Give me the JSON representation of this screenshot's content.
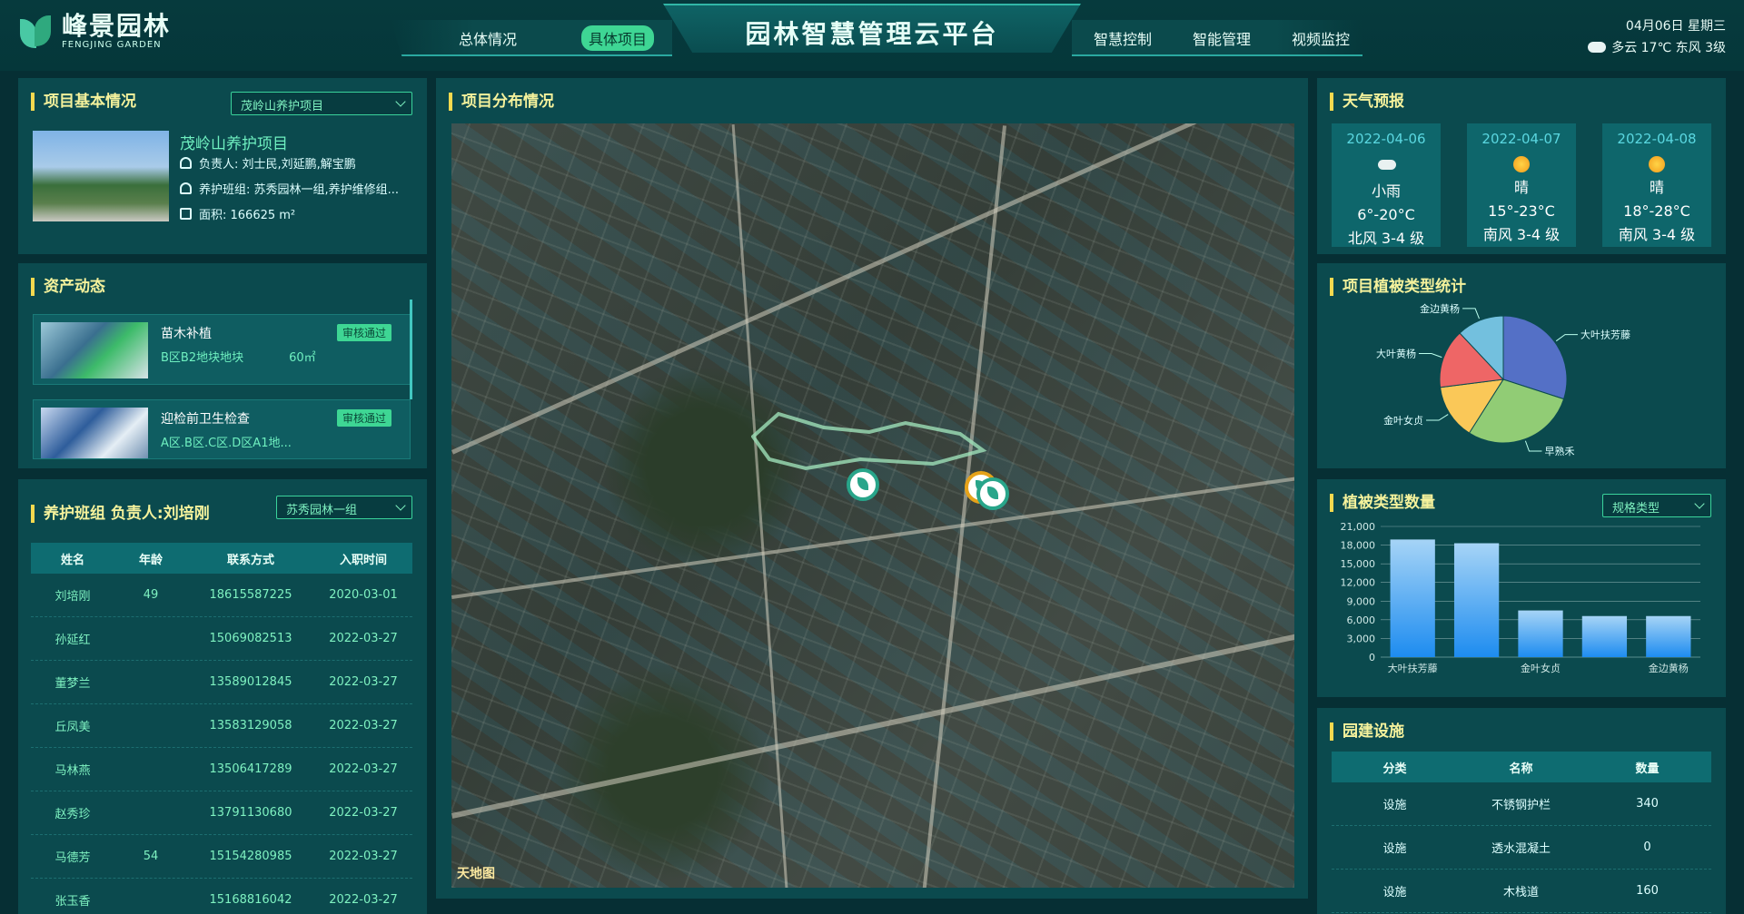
{
  "header": {
    "logo_cn": "峰景园林",
    "logo_en": "FENGJING GARDEN",
    "title": "园林智慧管理云平台",
    "nav_left": [
      "总体情况",
      "具体项目"
    ],
    "nav_right": [
      "智慧控制",
      "智能管理",
      "视频监控"
    ],
    "date": "04月06日 星期三",
    "weather": "多云 17℃ 东风 3级"
  },
  "project": {
    "title": "项目基本情况",
    "select": "茂岭山养护项目",
    "name": "茂岭山养护项目",
    "manager": "负责人: 刘士民,刘延鹏,解宝鹏",
    "team": "养护班组: 苏秀园林一组,养护维修组...",
    "area": "面积: 166625 m²"
  },
  "assets": {
    "title": "资产动态",
    "items": [
      {
        "title": "苗木补植",
        "sub": "B区B2地块地块",
        "qty": "60㎡",
        "badge": "审核通过"
      },
      {
        "title": "迎检前卫生检查",
        "sub": "A区.B区.C区.D区A1地...",
        "qty": "",
        "badge": "审核通过"
      }
    ]
  },
  "team": {
    "title": "养护班组 负责人:刘培刚",
    "select": "苏秀园林一组",
    "headers": [
      "姓名",
      "年龄",
      "联系方式",
      "入职时间"
    ],
    "rows": [
      [
        "刘培刚",
        "49",
        "18615587225",
        "2020-03-01"
      ],
      [
        "孙延红",
        "",
        "15069082513",
        "2022-03-27"
      ],
      [
        "董梦兰",
        "",
        "13589012845",
        "2022-03-27"
      ],
      [
        "丘凤美",
        "",
        "13583129058",
        "2022-03-27"
      ],
      [
        "马林燕",
        "",
        "13506417289",
        "2022-03-27"
      ],
      [
        "赵秀珍",
        "",
        "13791130680",
        "2022-03-27"
      ],
      [
        "马德芳",
        "54",
        "15154280985",
        "2022-03-27"
      ],
      [
        "张玉香",
        "",
        "15168816042",
        "2022-03-27"
      ]
    ]
  },
  "map": {
    "title": "项目分布情况",
    "watermark": "天地图"
  },
  "weather": {
    "title": "天气预报",
    "days": [
      {
        "date": "2022-04-06",
        "icon": "cloud-icon",
        "desc": "小雨",
        "temp": "6°-20°C",
        "wind": "北风 3-4 级"
      },
      {
        "date": "2022-04-07",
        "icon": "sun-icon",
        "desc": "晴",
        "temp": "15°-23°C",
        "wind": "南风 3-4 级"
      },
      {
        "date": "2022-04-08",
        "icon": "sun-icon",
        "desc": "晴",
        "temp": "18°-28°C",
        "wind": "南风 3-4 级"
      }
    ]
  },
  "chart_data": [
    {
      "type": "pie",
      "title": "项目植被类型统计",
      "slices": [
        {
          "name": "大叶扶芳藤",
          "value": 30,
          "color": "#5470c6"
        },
        {
          "name": "早熟禾",
          "value": 29,
          "color": "#91cc75"
        },
        {
          "name": "金叶女贞",
          "value": 14,
          "color": "#fac858"
        },
        {
          "name": "大叶黄杨",
          "value": 15,
          "color": "#ee6666"
        },
        {
          "name": "金边黄杨",
          "value": 12,
          "color": "#73c0de"
        }
      ]
    },
    {
      "type": "bar",
      "title": "植被类型数量",
      "select": "规格类型",
      "categories": [
        "大叶扶芳藤",
        "",
        "金叶女贞",
        "",
        "金边黄杨"
      ],
      "tick_labels": [
        "大叶扶芳藤",
        "金叶女贞",
        "金边黄杨"
      ],
      "values": [
        18900,
        18300,
        7500,
        6600,
        6600
      ],
      "ylim": [
        0,
        21000
      ],
      "yticks": [
        "0",
        "3,000",
        "6,000",
        "9,000",
        "12,000",
        "15,000",
        "18,000",
        "21,000"
      ]
    }
  ],
  "facilities": {
    "title": "园建设施",
    "headers": [
      "分类",
      "名称",
      "数量"
    ],
    "rows": [
      [
        "设施",
        "不锈钢护栏",
        "340"
      ],
      [
        "设施",
        "透水混凝土",
        "0"
      ],
      [
        "设施",
        "木栈道",
        "160"
      ]
    ]
  }
}
